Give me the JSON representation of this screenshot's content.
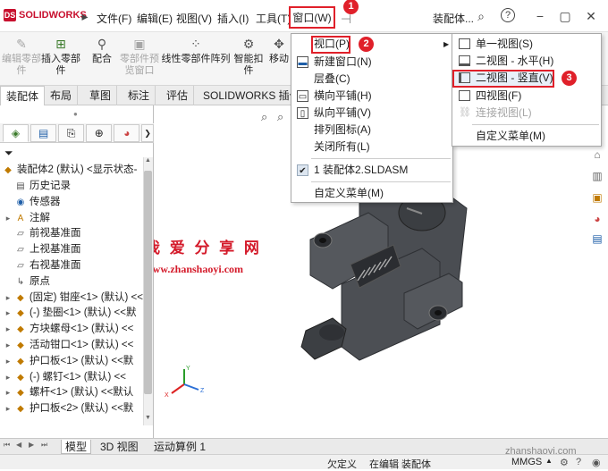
{
  "app": {
    "logo_text": "SOLIDWORKS"
  },
  "menubar": {
    "file": "文件(F)",
    "edit": "编辑(E)",
    "view": "视图(V)",
    "insert": "插入(I)",
    "tools": "工具(T)",
    "window": "窗口(W)",
    "doc_name": "装配体..."
  },
  "badges": {
    "b1": "1",
    "b2": "2",
    "b3": "3"
  },
  "ribbon": {
    "items": [
      {
        "label": "编辑零部件",
        "icon": "edit-part-icon",
        "disabled": true
      },
      {
        "label": "插入零部件",
        "icon": "insert-component-icon"
      },
      {
        "label": "配合",
        "icon": "mate-icon"
      },
      {
        "label": "零部件预览窗口",
        "icon": "preview-window-icon",
        "disabled": true
      },
      {
        "label": "线性零部件阵列",
        "icon": "linear-pattern-icon"
      },
      {
        "label": "智能扣件",
        "icon": "smart-fastener-icon"
      },
      {
        "label": "移动",
        "icon": "move-icon"
      }
    ]
  },
  "tabs": [
    "装配体",
    "布局",
    "草图",
    "标注",
    "评估",
    "SOLIDWORKS 插件"
  ],
  "tree": {
    "root": "装配体2 (默认) <显示状态-",
    "items": [
      {
        "label": "历史记录",
        "icon": "history-icon"
      },
      {
        "label": "传感器",
        "icon": "sensor-icon"
      },
      {
        "label": "注解",
        "icon": "annotation-icon"
      },
      {
        "label": "前视基准面",
        "icon": "plane-icon"
      },
      {
        "label": "上视基准面",
        "icon": "plane-icon"
      },
      {
        "label": "右视基准面",
        "icon": "plane-icon"
      },
      {
        "label": "原点",
        "icon": "origin-icon"
      },
      {
        "label": "(固定) 钳座<1> (默认) <<",
        "icon": "part-icon"
      },
      {
        "label": "(-) 垫圈<1> (默认) <<默",
        "icon": "part-icon"
      },
      {
        "label": "方块螺母<1> (默认) <<",
        "icon": "part-icon"
      },
      {
        "label": "活动钳口<1> (默认) <<",
        "icon": "part-icon"
      },
      {
        "label": "护口板<1> (默认) <<默",
        "icon": "part-icon"
      },
      {
        "label": "(-) 螺钉<1> (默认) <<",
        "icon": "part-icon"
      },
      {
        "label": "螺杆<1> (默认) <<默认",
        "icon": "part-icon"
      },
      {
        "label": "护口板<2> (默认) <<默",
        "icon": "part-icon"
      }
    ]
  },
  "window_menu": {
    "items": [
      {
        "label": "视口(P)",
        "has_submenu": true
      },
      {
        "label": "新建窗口(N)"
      },
      {
        "label": "层叠(C)"
      },
      {
        "label": "横向平铺(H)"
      },
      {
        "label": "纵向平铺(V)"
      },
      {
        "label": "排列图标(A)"
      },
      {
        "label": "关闭所有(L)"
      },
      {
        "label": "1 装配体2.SLDASM",
        "checked": true
      },
      {
        "label": "自定义菜单(M)"
      }
    ]
  },
  "viewport_menu": {
    "items": [
      {
        "label": "单一视图(S)"
      },
      {
        "label": "二视图 - 水平(H)"
      },
      {
        "label": "二视图 - 竖直(V)",
        "highlighted": true
      },
      {
        "label": "四视图(F)"
      },
      {
        "label": "连接视图(L)",
        "disabled": true
      },
      {
        "label": "自定义菜单(M)"
      }
    ]
  },
  "bottom_tabs": [
    "模型",
    "3D 视图",
    "运动算例 1"
  ],
  "status": {
    "under_defined": "欠定义",
    "editing": "在编辑 装配体",
    "units": "MMGS"
  },
  "watermark": {
    "cn": "我 爱 分 享 网",
    "url": "www.zhanshaoyi.com",
    "corner": "zhanshaoyi.com"
  },
  "colors": {
    "highlight_red": "#e0202a",
    "accent_blue": "#1f5fa8"
  }
}
